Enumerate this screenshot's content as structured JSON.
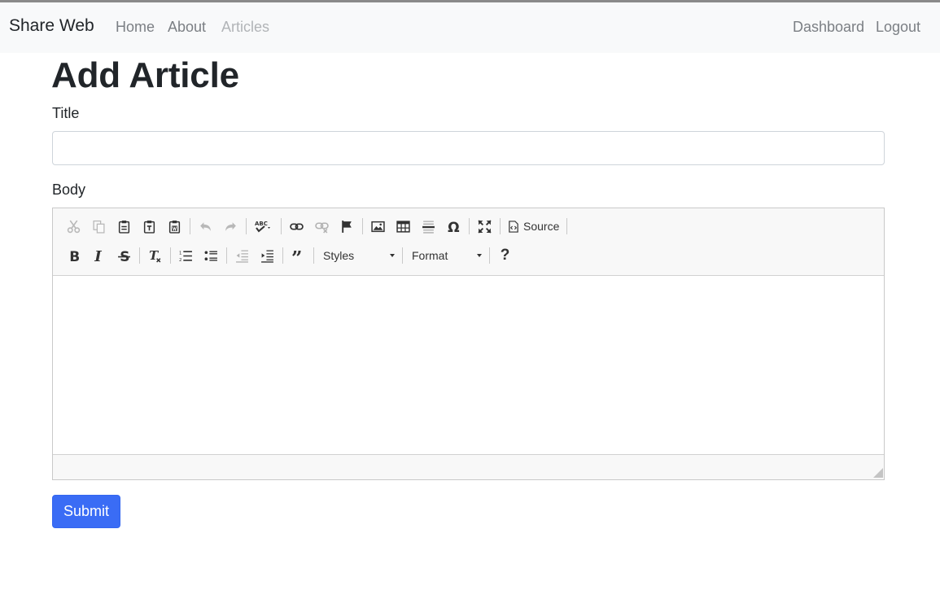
{
  "navbar": {
    "brand": "Share Web",
    "links": [
      {
        "label": "Home"
      },
      {
        "label": "About"
      },
      {
        "label": "Articles",
        "active": true
      }
    ],
    "right_links": [
      {
        "label": "Dashboard"
      },
      {
        "label": "Logout"
      }
    ]
  },
  "page": {
    "title": "Add Article"
  },
  "form": {
    "title_label": "Title",
    "title_value": "",
    "body_label": "Body",
    "submit_label": "Submit"
  },
  "editor": {
    "toolbar_row1": [
      {
        "icon": "cut-icon",
        "enabled": false
      },
      {
        "icon": "copy-icon",
        "enabled": false
      },
      {
        "icon": "paste-icon",
        "enabled": true
      },
      {
        "icon": "paste-text-icon",
        "enabled": true
      },
      {
        "icon": "paste-from-word-icon",
        "enabled": true
      },
      {
        "icon": "undo-icon",
        "enabled": false
      },
      {
        "icon": "redo-icon",
        "enabled": false
      },
      {
        "icon": "spellcheck-icon",
        "enabled": true
      },
      {
        "icon": "link-icon",
        "enabled": true
      },
      {
        "icon": "unlink-icon",
        "enabled": false
      },
      {
        "icon": "anchor-icon",
        "enabled": true
      },
      {
        "icon": "image-icon",
        "enabled": true
      },
      {
        "icon": "table-icon",
        "enabled": true
      },
      {
        "icon": "horizontal-line-icon",
        "enabled": true
      },
      {
        "icon": "special-char-icon",
        "enabled": true
      },
      {
        "icon": "maximize-icon",
        "enabled": true
      }
    ],
    "source_label": "Source",
    "styles_label": "Styles",
    "format_label": "Format",
    "help_glyph": "?",
    "colors": {
      "toolbar_bg": "#f8f8f8",
      "border": "#c9c9c9",
      "accent": "#3a6cf5"
    }
  }
}
